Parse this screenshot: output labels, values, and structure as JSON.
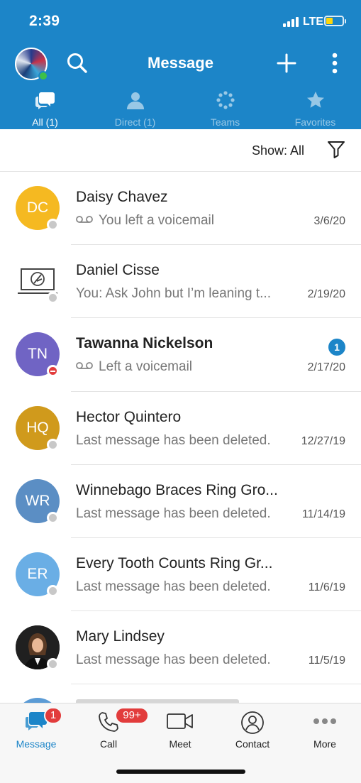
{
  "status_bar": {
    "time": "2:39",
    "network": "LTE"
  },
  "header": {
    "title": "Message"
  },
  "tabs": [
    {
      "label": "All (1)",
      "icon": "chat-bubbles-icon",
      "active": true
    },
    {
      "label": "Direct (1)",
      "icon": "person-icon",
      "active": false
    },
    {
      "label": "Teams",
      "icon": "teams-dots-icon",
      "active": false
    },
    {
      "label": "Favorites",
      "icon": "star-icon",
      "active": false
    }
  ],
  "filter": {
    "label": "Show: All"
  },
  "conversations": [
    {
      "name": "Daisy Chavez",
      "initials": "DC",
      "avatar_color": "#f5b921",
      "preview": "You left a voicemail",
      "voicemail": true,
      "date": "3/6/20",
      "presence": "offline",
      "unread": 0
    },
    {
      "name": "Daniel Cisse",
      "initials": "",
      "avatar_color": "#ffffff",
      "preview": "You: Ask John but I’m leaning t...",
      "voicemail": false,
      "date": "2/19/20",
      "presence": "offline",
      "unread": 0
    },
    {
      "name": "Tawanna Nickelson",
      "initials": "TN",
      "avatar_color": "#7064c4",
      "preview": "Left a voicemail",
      "voicemail": true,
      "date": "2/17/20",
      "presence": "dnd",
      "unread": 1
    },
    {
      "name": "Hector Quintero",
      "initials": "HQ",
      "avatar_color": "#d09a1c",
      "preview": "Last message has been deleted.",
      "voicemail": false,
      "date": "12/27/19",
      "presence": "offline",
      "unread": 0
    },
    {
      "name": "Winnebago Braces Ring Gro...",
      "initials": "WR",
      "avatar_color": "#5b8ec4",
      "preview": "Last message has been deleted.",
      "voicemail": false,
      "date": "11/14/19",
      "presence": "offline",
      "unread": 0
    },
    {
      "name": "Every Tooth Counts Ring Gr...",
      "initials": "ER",
      "avatar_color": "#6aaee5",
      "preview": "Last message has been deleted.",
      "voicemail": false,
      "date": "11/6/19",
      "presence": "offline",
      "unread": 0
    },
    {
      "name": "Mary Lindsey",
      "initials": "",
      "avatar_color": "#1e1e1e",
      "preview": "Last message has been deleted.",
      "voicemail": false,
      "date": "11/5/19",
      "presence": "offline",
      "unread": 0
    }
  ],
  "bottom_nav": [
    {
      "label": "Message",
      "icon": "message-icon",
      "badge": "1",
      "active": true
    },
    {
      "label": "Call",
      "icon": "phone-icon",
      "badge": "99+",
      "active": false
    },
    {
      "label": "Meet",
      "icon": "video-camera-icon",
      "badge": "",
      "active": false
    },
    {
      "label": "Contact",
      "icon": "contact-icon",
      "badge": "",
      "active": false
    },
    {
      "label": "More",
      "icon": "more-dots-icon",
      "badge": "",
      "active": false
    }
  ],
  "colors": {
    "brand": "#1c85c8",
    "dnd": "#e23c3c",
    "online": "#3dc04a"
  }
}
